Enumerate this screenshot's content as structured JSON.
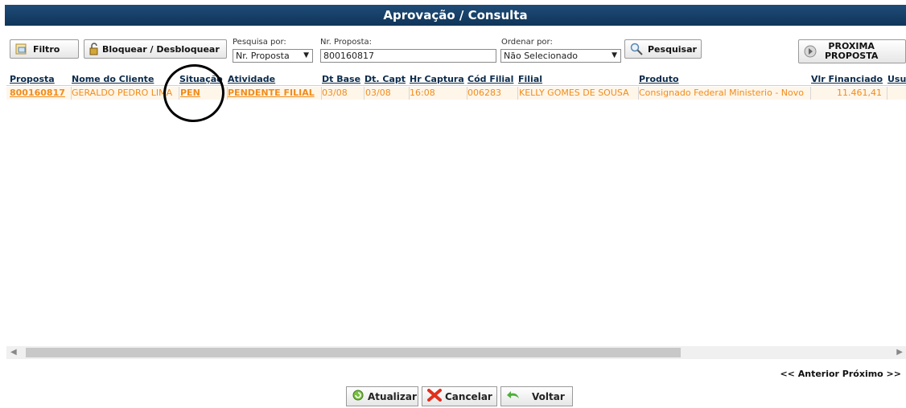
{
  "title": "Aprovação / Consulta",
  "toolbar": {
    "filtro": "Filtro",
    "bloquear": "Bloquear / Desbloquear",
    "pesquisa_por_label": "Pesquisa por:",
    "pesquisa_por_value": "Nr. Proposta",
    "nr_proposta_label": "Nr. Proposta:",
    "nr_proposta_value": "800160817",
    "ordenar_por_label": "Ordenar por:",
    "ordenar_por_value": "Não Selecionado",
    "pesquisar": "Pesquisar",
    "proxima_1": "PROXIMA",
    "proxima_2": "PROPOSTA"
  },
  "table": {
    "headers": [
      "Proposta",
      "Nome do Cliente",
      "Situação",
      "Atividade",
      "Dt Base",
      "Dt. Capt",
      "Hr Captura",
      "Cód Filial",
      "Filial",
      "Produto",
      "Vlr Financiado",
      "Usu"
    ],
    "row": [
      "800160817",
      "GERALDO PEDRO LIMA",
      "PEN",
      "PENDENTE FILIAL",
      "03/08",
      "03/08",
      "16:08",
      "006283",
      "KELLY GOMES DE SOUSA",
      "Consignado Federal Ministerio - Novo",
      "11.461,41",
      ""
    ]
  },
  "pager": "<< Anterior Próximo >>",
  "bottom": {
    "atualizar": "Atualizar",
    "cancelar": "Cancelar",
    "voltar": "Voltar"
  },
  "colors": {
    "title_bg": "#0f3559",
    "row_text": "#f08c1a"
  }
}
